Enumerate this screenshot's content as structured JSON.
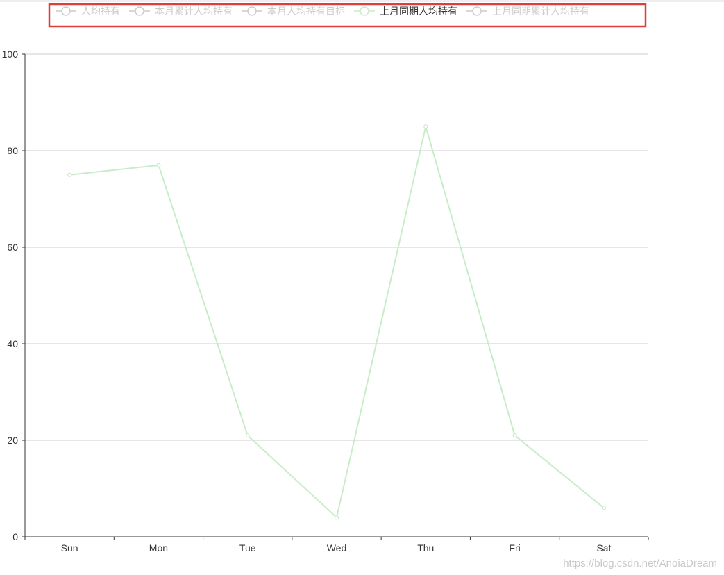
{
  "chart_data": {
    "type": "line",
    "categories": [
      "Sun",
      "Mon",
      "Tue",
      "Wed",
      "Thu",
      "Fri",
      "Sat"
    ],
    "ylim": [
      0,
      100
    ],
    "yticks": [
      0,
      20,
      40,
      60,
      80,
      100
    ],
    "grid": true,
    "legend": {
      "placement": "top",
      "items": [
        {
          "label": "人均持有",
          "active": false
        },
        {
          "label": "本月累计人均持有",
          "active": false
        },
        {
          "label": "本月人均持有目标",
          "active": false
        },
        {
          "label": "上月同期人均持有",
          "active": true
        },
        {
          "label": "上月同期累计人均持有",
          "active": false
        }
      ],
      "highlight_color": "#e03c3c"
    },
    "series": [
      {
        "name": "上月同期人均持有",
        "values": [
          75,
          77,
          21,
          4,
          85,
          21,
          6
        ],
        "color": "#c8ecc8"
      }
    ],
    "colors": {
      "axis": "#333333",
      "grid": "#cccccc",
      "label": "#333333",
      "legend_inactive": "#cccccc",
      "legend_active": "#333333"
    }
  },
  "watermark": "https://blog.csdn.net/AnoiaDream"
}
